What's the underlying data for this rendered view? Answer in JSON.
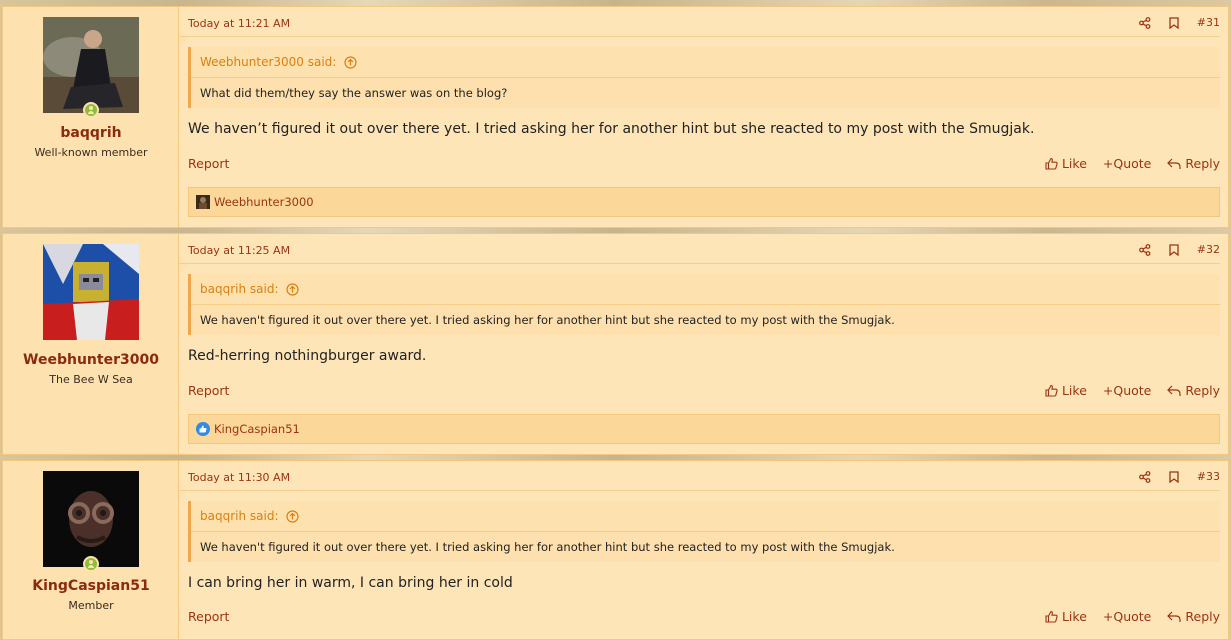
{
  "posts": [
    {
      "username": "baqqrih",
      "user_title": "Well-known member",
      "online": true,
      "date": "Today at 11:21 AM",
      "post_number": "#31",
      "quote_author": "Weebhunter3000 said:",
      "quote_text": "What did them/they say the answer was on the blog?",
      "message": "We haven’t figured it out over there yet. I tried asking her for another hint but she reacted to my post with the Smugjak.",
      "report": "Report",
      "like": "Like",
      "quote": "+Quote",
      "reply": "Reply",
      "reaction_user": "Weebhunter3000",
      "reaction_icon": "user-avatar-icon"
    },
    {
      "username": "Weebhunter3000",
      "user_title": "The Bee W Sea",
      "online": false,
      "date": "Today at 11:25 AM",
      "post_number": "#32",
      "quote_author": "baqqrih said:",
      "quote_text": "We haven't figured it out over there yet. I tried asking her for another hint but she reacted to my post with the Smugjak.",
      "message": "Red-herring nothingburger award.",
      "report": "Report",
      "like": "Like",
      "quote": "+Quote",
      "reply": "Reply",
      "reaction_user": "KingCaspian51",
      "reaction_icon": "like-reaction-icon"
    },
    {
      "username": "KingCaspian51",
      "user_title": "Member",
      "online": true,
      "date": "Today at 11:30 AM",
      "post_number": "#33",
      "quote_author": "baqqrih said:",
      "quote_text": "We haven't figured it out over there yet. I tried asking her for another hint but she reacted to my post with the Smugjak.",
      "message": "I can bring her in warm, I can bring her in cold",
      "report": "Report",
      "like": "Like",
      "quote": "+Quote",
      "reply": "Reply"
    }
  ],
  "colors": {
    "post_bg": "#fde5b8",
    "accent": "#9a3412",
    "quote_accent": "#d88012",
    "online": "#8fbc3a"
  }
}
